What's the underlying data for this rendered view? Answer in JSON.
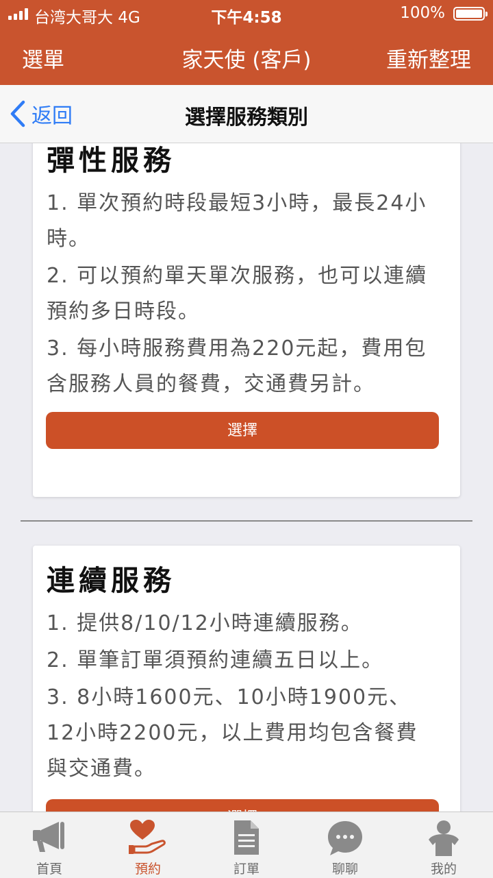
{
  "status": {
    "carrier": "台湾大哥大   4G",
    "time": "下午4:58",
    "battery": "100%"
  },
  "header": {
    "menu": "選單",
    "title": "家天使 (客戶)",
    "refresh": "重新整理"
  },
  "subheader": {
    "back": "返回",
    "title": "選擇服務類別"
  },
  "cards": [
    {
      "title": "彈性服務",
      "items": [
        "1. 單次預約時段最短3小時，最長24小時。",
        "2. 可以預約單天單次服務，也可以連續預約多日時段。",
        "3. 每小時服務費用為220元起，費用包含服務人員的餐費，交通費另計。"
      ],
      "button": "選擇"
    },
    {
      "title": "連續服務",
      "items": [
        "1. 提供8/10/12小時連續服務。",
        "2. 單筆訂單須預約連續五日以上。",
        "3. 8小時1600元、10小時1900元、12小時2200元，以上費用均包含餐費與交通費。"
      ],
      "button": "選擇"
    }
  ],
  "tabs": [
    {
      "label": "首頁",
      "icon": "megaphone-icon",
      "active": false
    },
    {
      "label": "預約",
      "icon": "heart-hand-icon",
      "active": true
    },
    {
      "label": "訂單",
      "icon": "document-icon",
      "active": false
    },
    {
      "label": "聊聊",
      "icon": "chat-bubble-icon",
      "active": false
    },
    {
      "label": "我的",
      "icon": "person-icon",
      "active": false
    }
  ],
  "colors": {
    "brand": "#c9542e",
    "button": "#cc5027",
    "link": "#2f7cf6",
    "tab_inactive": "#6b6b6b"
  }
}
